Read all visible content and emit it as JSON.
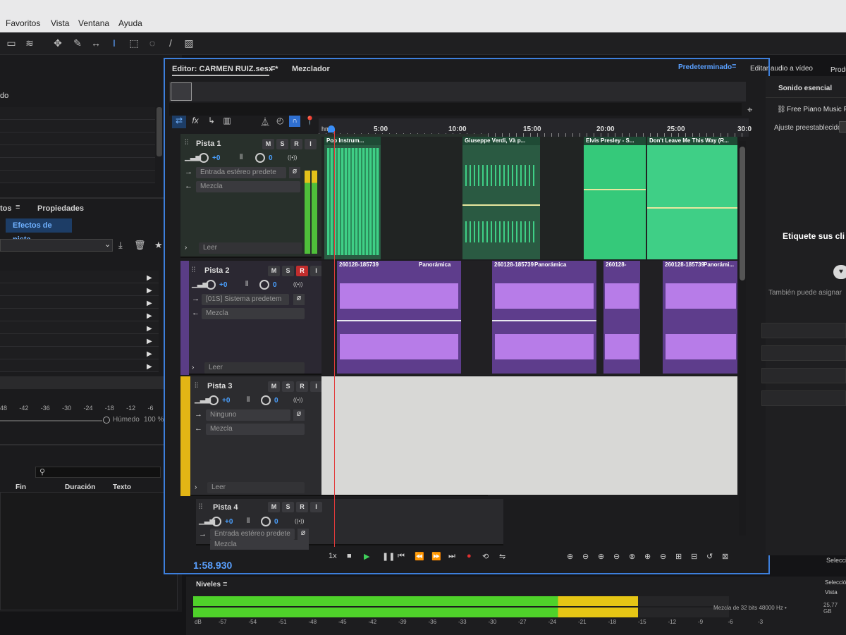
{
  "menu": [
    "Favoritos",
    "Vista",
    "Ventana",
    "Ayuda"
  ],
  "left": {
    "label_do": "do",
    "tabs": [
      "tos",
      "Propiedades"
    ],
    "effects_tab": "Efectos de pista",
    "scale": [
      "48",
      "-42",
      "-36",
      "-30",
      "-24",
      "-18",
      "-12",
      "-6",
      "0"
    ],
    "wet_label": "Húmedo",
    "wet_value": "100 %",
    "markers_cols": [
      "Fin",
      "Duración",
      "Texto"
    ]
  },
  "editor": {
    "tab_editor": "Editor: CARMEN RUIZ.sesx *",
    "tab_mixer": "Mezclador",
    "workspace_default": "Predeterminado",
    "workspace_video": "Editar audio a vídeo",
    "workspace_prod": "Produ"
  },
  "ruler": {
    "unit": "hms",
    "ticks": [
      "5:00",
      "10:00",
      "15:00",
      "20:00",
      "25:00",
      "30:0"
    ]
  },
  "tracks": [
    {
      "name": "Pista 1",
      "volume": "+0",
      "pan": "0",
      "input": "Entrada estéreo predete",
      "output": "Mezcla",
      "mode": "Leer",
      "recording": false
    },
    {
      "name": "Pista 2",
      "volume": "+0",
      "pan": "0",
      "input": "[01S] Sistema predetem",
      "output": "Mezcla",
      "mode": "Leer",
      "recording": true
    },
    {
      "name": "Pista 3",
      "volume": "+0",
      "pan": "0",
      "input": "Ninguno",
      "output": "Mezcla",
      "mode": "Leer",
      "recording": false
    },
    {
      "name": "Pista 4",
      "volume": "+0",
      "pan": "0",
      "input": "Entrada estéreo predete",
      "output": "Mezcla",
      "mode": "",
      "recording": false
    }
  ],
  "buttons": {
    "mute": "M",
    "solo": "S",
    "rec": "R",
    "input": "I"
  },
  "clips": {
    "track1": [
      "Pop Instrum...",
      "Giuseppe Verdi, Và p...",
      "Elvis Presley - S...",
      "Don't Leave Me This Way (R..."
    ],
    "track2_name": "260128-185739",
    "track2_short": "260128-",
    "track2_effect": "Panorámica",
    "track2_effect_short": "Panorámi..."
  },
  "transport": {
    "time": "1:58.930",
    "speed": "1x"
  },
  "right": {
    "tab": "Sonido esencial",
    "preset_item": "Free Piano Music For",
    "preset_label": "Ajuste preestablecido:",
    "tag_text": "Etiquete sus cli",
    "assign_text": "También puede asignar",
    "select_label": "Seleccić",
    "sel_label": "Selecció",
    "view_label": "Vista",
    "disk": "25,77 GB"
  },
  "levels": {
    "title": "Niveles",
    "db_unit": "dB",
    "scale": [
      "-57",
      "-54",
      "-51",
      "-48",
      "-45",
      "-42",
      "-39",
      "-36",
      "-33",
      "-30",
      "-27",
      "-24",
      "-21",
      "-18",
      "-15",
      "-12",
      "-9",
      "-6",
      "-3"
    ],
    "status": "Mezcla de 32 bits 48000 Hz •",
    "level_fraction": 0.83
  },
  "colors": {
    "track1": "#3fcf86",
    "track2": "#b77ce8",
    "track3": "#d8d8d6",
    "accent": "#3d7fdc",
    "track3_tab": "#e2b515"
  }
}
